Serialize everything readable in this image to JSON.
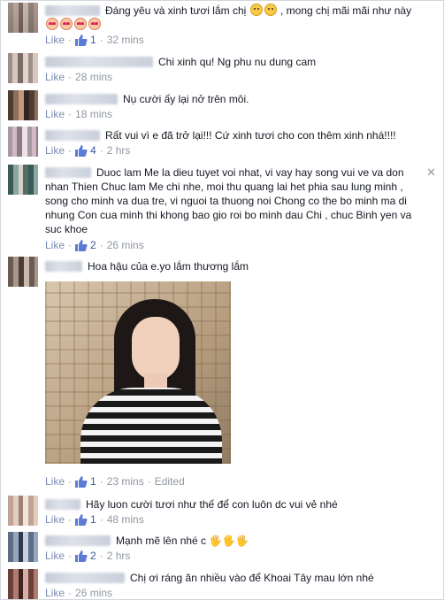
{
  "like_label": "Like",
  "comments": [
    {
      "text": "Đáng yêu và xinh tươi lắm chị",
      "text_suffix": ", mong chị mãi mãi như này",
      "emojis_inline": [
        "smile-emoji",
        "sweat-emoji"
      ],
      "emojis_after": [
        "heart-eyes-emoji",
        "heart-eyes-emoji",
        "heart-eyes-emoji",
        "heart-eyes-emoji"
      ],
      "likes": "1",
      "time": "32 mins"
    },
    {
      "text": "Chi xinh qu! Ng phu nu dung cam",
      "likes": "",
      "time": "28 mins"
    },
    {
      "text": "Nụ cười ấy lại nở trên môi.",
      "likes": "",
      "time": "18 mins"
    },
    {
      "text": "Rất vui vì e đã trở lại!!! Cứ xinh tươi cho con thêm xinh nhá!!!!",
      "likes": "4",
      "time": "2 hrs"
    },
    {
      "text": "Duoc lam Me la dieu tuyet voi nhat, vi vay hay song vui ve va don nhan Thien Chuc lam Me chi nhe, moi thu quang lai het phia sau lung minh , song cho minh va dua tre, vi nguoi ta thuong noi Chong co the bo minh ma di nhung Con cua minh thi khong bao gio roi bo minh dau Chi , chuc Binh yen va suc khoe",
      "likes": "2",
      "time": "26 mins"
    },
    {
      "text": "Hoa hậu của e.yo lắm thương lắm",
      "likes": "1",
      "time": "23 mins",
      "edited": "Edited"
    },
    {
      "text": "Hãy luon cười tươi như thế để con luôn dc vui vẻ nhé",
      "likes": "1",
      "time": "48 mins"
    },
    {
      "text": "Mạnh mẽ lên nhé c",
      "emojis_after": [
        "wave-emoji",
        "wave-emoji",
        "wave-emoji"
      ],
      "likes": "2",
      "time": "2 hrs"
    },
    {
      "text": "Chị ơi ráng ăn nhiều vào để Khoai Tây mau lớn nhé",
      "likes": "",
      "time": "26 mins"
    }
  ],
  "colors": {
    "link": "#3b5998",
    "meta": "#9197a3",
    "text": "#141823"
  }
}
